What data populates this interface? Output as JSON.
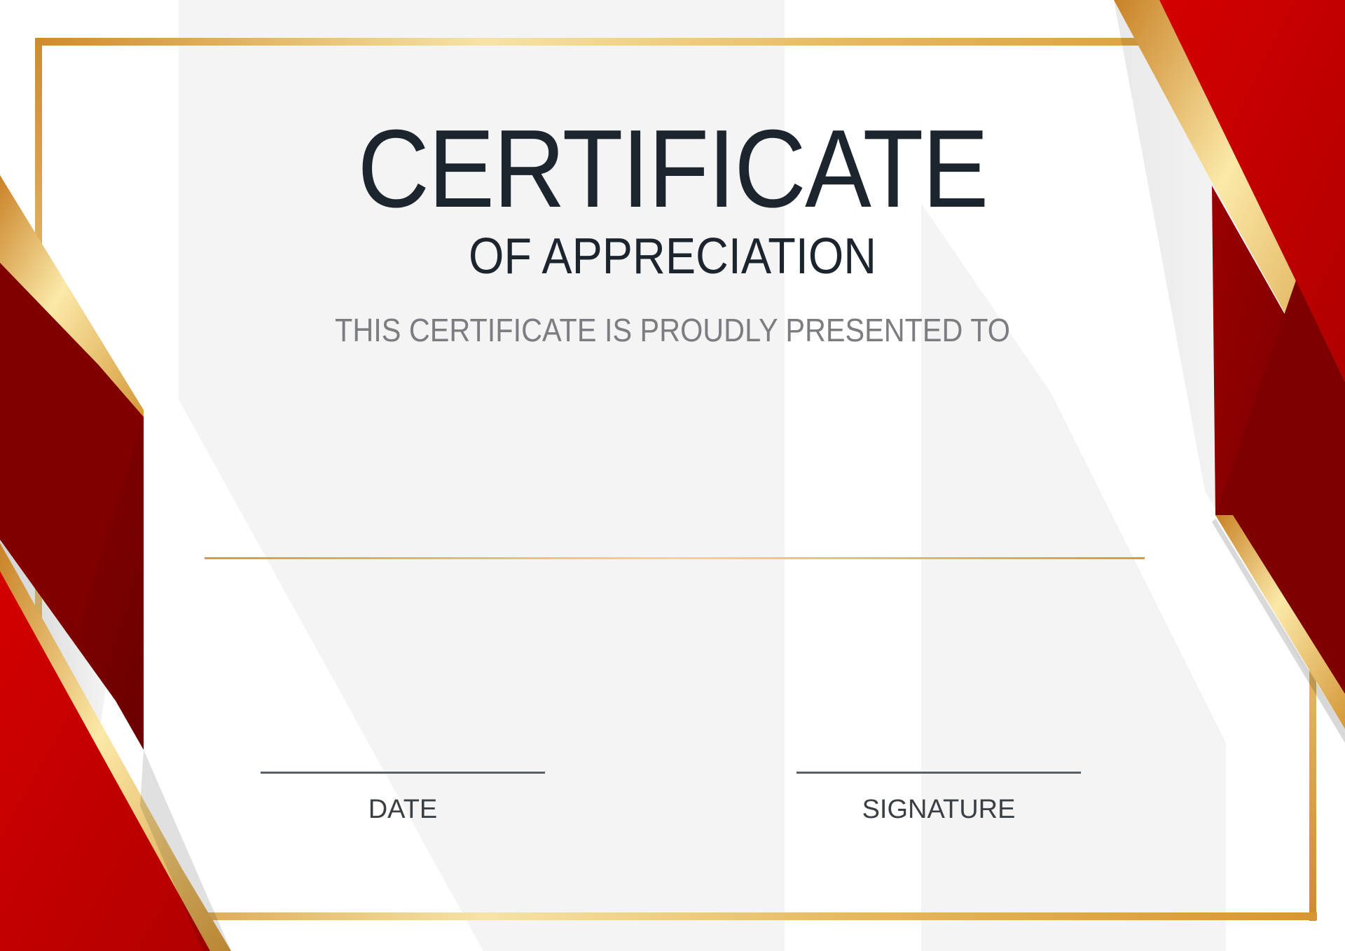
{
  "certificate": {
    "title": "CERTIFICATE",
    "subtitle": "OF APPRECIATION",
    "presented_text": "THIS CERTIFICATE IS PROUDLY PRESENTED TO",
    "date_label": "DATE",
    "signature_label": "SIGNATURE"
  },
  "colors": {
    "background": "#ffffff",
    "panel_gray": "#f4f4f4",
    "title_text": "#1c242d",
    "body_text": "#7b7d80",
    "gold": "#d8a040",
    "gold_light": "#f4dc94",
    "red": "#c80000",
    "dark_red": "#8a0000"
  }
}
